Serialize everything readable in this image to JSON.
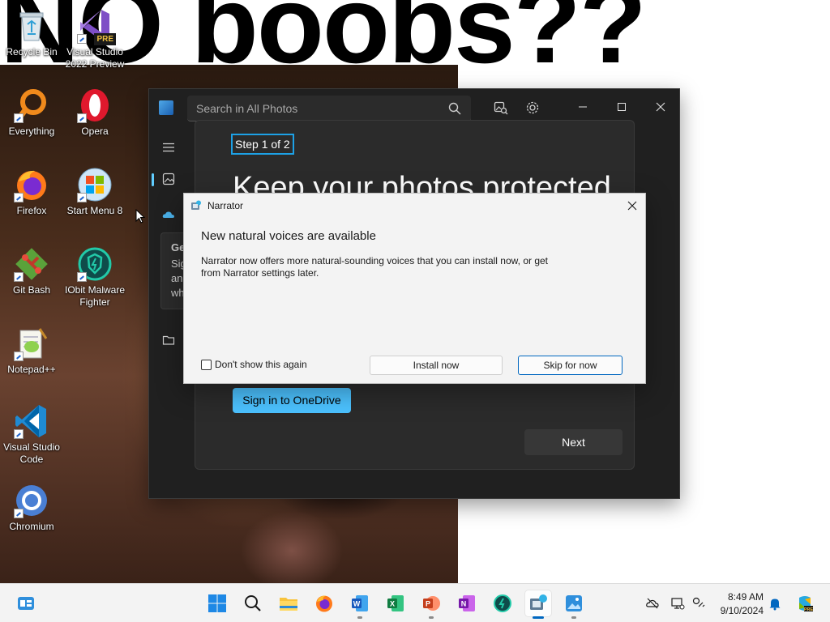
{
  "wallpaper": {
    "text": "NO boobs??"
  },
  "desktop_icons": [
    {
      "label": "Recycle Bin",
      "icon": "recycle-bin-icon"
    },
    {
      "label": "Visual Studio 2022 Preview",
      "icon": "visual-studio-preview-icon",
      "badge": "PRE"
    },
    {
      "label": "Everything",
      "icon": "everything-search-icon"
    },
    {
      "label": "Opera",
      "icon": "opera-icon"
    },
    {
      "label": "Firefox",
      "icon": "firefox-icon"
    },
    {
      "label": "Start Menu 8",
      "icon": "start-menu-8-icon"
    },
    {
      "label": "Git Bash",
      "icon": "git-bash-icon"
    },
    {
      "label": "IObit Malware Fighter",
      "icon": "iobit-malware-fighter-icon"
    },
    {
      "label": "Notepad++",
      "icon": "notepad-plus-plus-icon"
    },
    {
      "label": "Visual Studio Code",
      "icon": "vscode-icon"
    },
    {
      "label": "Chromium",
      "icon": "chromium-icon"
    }
  ],
  "photos": {
    "search_placeholder": "Search in All Photos",
    "step_label": "Step 1 of 2",
    "heading": "Keep your photos protected",
    "onedrive_button": "Sign in to OneDrive",
    "next_button": "Next",
    "side_card_lines": [
      "Ge",
      "Sig",
      "an",
      "wh"
    ],
    "accent_color": "#4cc2ff"
  },
  "narrator": {
    "title": "Narrator",
    "heading": "New natural voices are available",
    "body": "Narrator now offers more natural-sounding voices that you can install now, or get from Narrator settings later.",
    "dont_show_label": "Don't show this again",
    "dont_show_checked": false,
    "install_button": "Install now",
    "skip_button": "Skip for now",
    "focus_color": "#0067c0"
  },
  "taskbar": {
    "apps": [
      "windows-start-icon",
      "search-icon",
      "file-explorer-icon",
      "firefox-icon",
      "word-icon",
      "excel-icon",
      "powerpoint-icon",
      "onenote-icon",
      "iobit-icon",
      "narrator-icon",
      "photos-icon"
    ],
    "time": "8:49 AM",
    "date": "9/10/2024"
  }
}
